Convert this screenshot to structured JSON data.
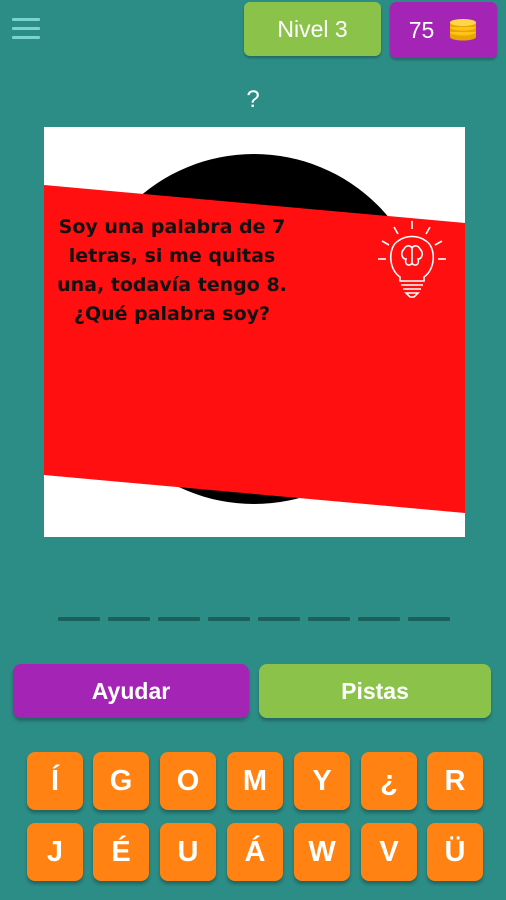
{
  "header": {
    "level_label": "Nivel 3",
    "coins": "75",
    "menu_icon": "hamburger-menu-icon",
    "coins_icon": "coin-stack-icon"
  },
  "question_mark": "?",
  "riddle": {
    "text": "Soy una palabra de 7 letras, si me quitas una, todavía tengo 8. ¿Qué palabra soy?",
    "icon": "lightbulb-brain-icon"
  },
  "answer_slots": [
    "",
    "",
    "",
    "",
    "",
    "",
    "",
    ""
  ],
  "buttons": {
    "help_label": "Ayudar",
    "hints_label": "Pistas"
  },
  "keyboard": {
    "row1": [
      "Í",
      "G",
      "O",
      "M",
      "Y",
      "¿",
      "R"
    ],
    "row2": [
      "J",
      "É",
      "U",
      "Á",
      "W",
      "V",
      "Ü"
    ]
  },
  "colors": {
    "background": "#2c8c86",
    "level_badge": "#8bc34a",
    "coins_badge": "#a425b5",
    "key": "#ff8212",
    "card_band": "#ff0f0f"
  }
}
